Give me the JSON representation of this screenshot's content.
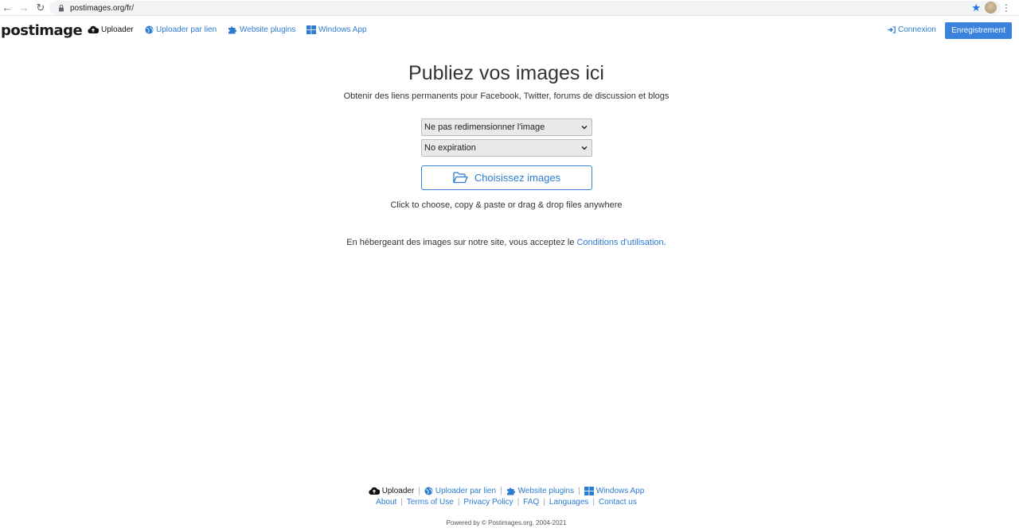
{
  "browser": {
    "url": "postimages.org/fr/"
  },
  "header": {
    "logo": "postimage",
    "nav": {
      "uploader": "Uploader",
      "upload_by_link": "Uploader par lien",
      "website_plugins": "Website plugins",
      "windows_app": "Windows App"
    },
    "login": "Connexion",
    "register": "Enregistrement"
  },
  "main": {
    "title": "Publiez vos images ici",
    "subtitle": "Obtenir des liens permanents pour Facebook, Twitter, forums de discussion et blogs",
    "resize_select": "Ne pas redimensionner l'image",
    "expiration_select": "No expiration",
    "choose_button": "Choisissez images",
    "hint": "Click to choose, copy & paste or drag & drop files anywhere",
    "terms_prefix": "En hébergeant des images sur notre site, vous acceptez le ",
    "terms_link": "Conditions d'utilisation",
    "terms_suffix": "."
  },
  "footer": {
    "row1": {
      "uploader": "Uploader",
      "upload_by_link": "Uploader par lien",
      "website_plugins": "Website plugins",
      "windows_app": "Windows App"
    },
    "row2": [
      "About",
      "Terms of Use",
      "Privacy Policy",
      "FAQ",
      "Languages",
      "Contact us"
    ],
    "powered": "Powered by © Postimages.org, 2004-2021"
  },
  "colors": {
    "accent": "#3a82dc",
    "link": "#2b7bd1"
  }
}
